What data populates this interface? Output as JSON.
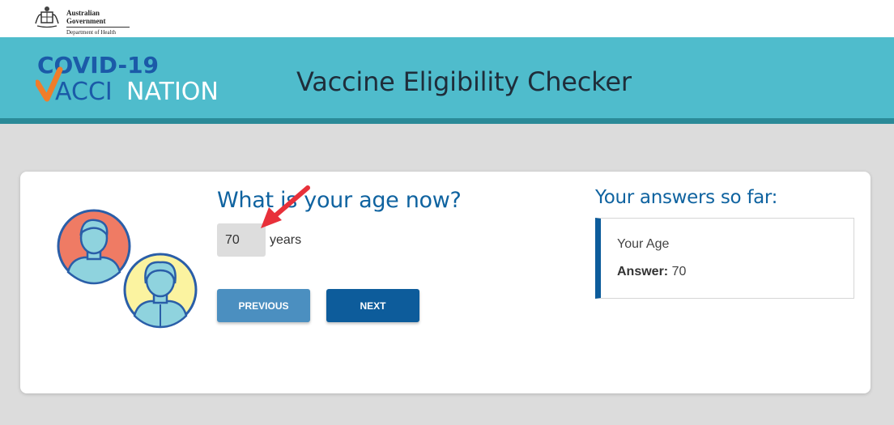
{
  "gov": {
    "line1": "Australian Government",
    "line2": "Department of Health"
  },
  "logo": {
    "line1": "COVID-19",
    "line2a": "ACCI",
    "line2b": "NATION",
    "colors": {
      "blue": "#1b5aa8",
      "orange": "#f07d2a",
      "white": "#ffffff"
    }
  },
  "banner": {
    "title": "Vaccine Eligibility Checker"
  },
  "question": {
    "text": "What is your age now?",
    "value": "70",
    "unit": "years"
  },
  "buttons": {
    "previous": "PREVIOUS",
    "next": "NEXT"
  },
  "answers": {
    "title": "Your answers so far:",
    "item_label": "Your Age",
    "answer_label": "Answer:",
    "answer_value": "70"
  },
  "colors": {
    "banner": "#4fbccc",
    "accent_blue": "#0f63a0",
    "button_dark": "#0d5c9b",
    "button_light": "#4b8fc0",
    "annotation_arrow": "#e8303a"
  },
  "icons": [
    "coat-of-arms-icon",
    "person-red-icon",
    "person-yellow-icon",
    "red-arrow-icon",
    "checkmark-icon"
  ]
}
